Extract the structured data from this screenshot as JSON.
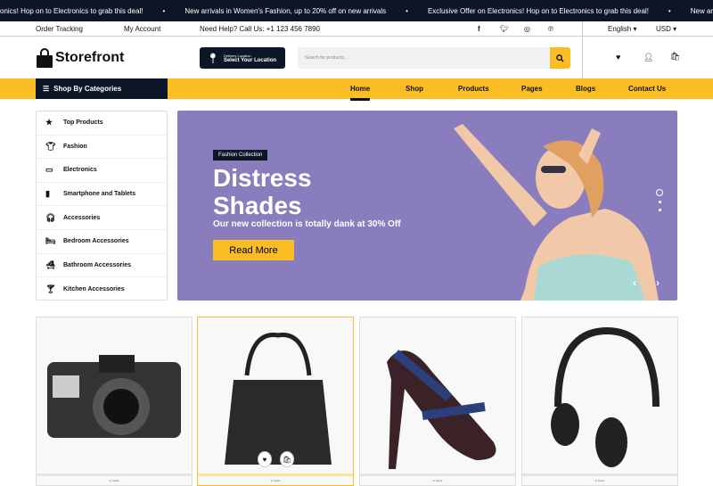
{
  "ticker": [
    "onics! Hop on to Electronics to grab this deal!",
    "New arrivals in Women's Fashion, up to 20% off on new arrivals",
    "Exclusive Offer on Electronics! Hop on to Electronics to grab this deal!",
    "New arrivals in Women's Fashion"
  ],
  "topbar": {
    "order_tracking": "Order Tracking",
    "my_account": "My Account",
    "help": "Need Help? Call Us: +1 123 456 7890",
    "language": "English",
    "currency": "USD"
  },
  "header": {
    "logo": "Storefront",
    "delivery_label": "Delivery Location",
    "delivery_value": "Select Your Location",
    "search_placeholder": "Search for products..."
  },
  "nav": {
    "categories_label": "Shop By Categories",
    "items": [
      "Home",
      "Shop",
      "Products",
      "Pages",
      "Blogs",
      "Contact Us"
    ],
    "active": "Home"
  },
  "sidebar": [
    {
      "icon": "star",
      "label": "Top Products"
    },
    {
      "icon": "tshirt",
      "label": "Fashion"
    },
    {
      "icon": "tv",
      "label": "Electronics"
    },
    {
      "icon": "mobile",
      "label": "Smartphone and Tablets"
    },
    {
      "icon": "headphones",
      "label": "Accessories"
    },
    {
      "icon": "bed",
      "label": "Bedroom Accessories"
    },
    {
      "icon": "bath",
      "label": "Bathroom Accessories"
    },
    {
      "icon": "cocktail",
      "label": "Kitchen Accessories"
    }
  ],
  "hero": {
    "tag": "Fashion Collection",
    "title_1": "Distress",
    "title_2": "Shades",
    "subtitle": "Our new collection is totally dank at 30% Off",
    "button": "Read More",
    "slides": 3,
    "active_slide": 1
  },
  "products": [
    {
      "name": "camera",
      "stock": "In Stock"
    },
    {
      "name": "handbag",
      "stock": "In Stock"
    },
    {
      "name": "high heel",
      "stock": "In Stock"
    },
    {
      "name": "headphones",
      "stock": "In Stock"
    }
  ],
  "colors": {
    "accent": "#fbbd24",
    "dark": "#0c1626",
    "hero_bg": "#897dbd"
  }
}
